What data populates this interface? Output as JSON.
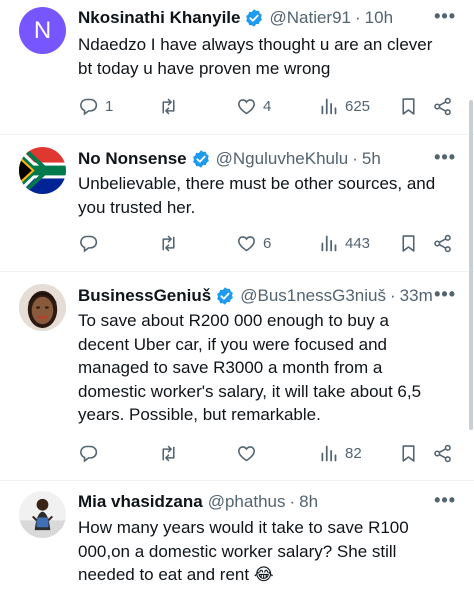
{
  "tweets": [
    {
      "name": "Nkosinathi Khanyile",
      "handle": "@Natier91",
      "time": "10h",
      "avatar_letter": "N",
      "avatar_color": "#7856ff",
      "verified": true,
      "lines": [
        "Ndaedzo I have always thought u are an clever",
        "bt today u have proven me wrong"
      ],
      "replies": "1",
      "retweets": "",
      "likes": "4",
      "views": "625"
    },
    {
      "name": "No Nonsense",
      "handle": "@NguluvheKhulu",
      "time": "5h",
      "avatar_icon": "south-africa-flag-icon",
      "verified": true,
      "lines": [
        "Unbelievable, there must be other sources, and",
        "you trusted her."
      ],
      "replies": "",
      "retweets": "",
      "likes": "6",
      "views": "443"
    },
    {
      "name": "BusinessGeniuš",
      "handle": "@Bus1nessG3niuš",
      "time": "33m",
      "avatar_icon": "profile-photo",
      "verified": true,
      "lines": [
        "To save about R200 000 enough to buy a",
        "decent Uber car, if you were focused and",
        "managed to save R3000 a month from a",
        "domestic worker's salary, it will take about 6,5",
        "years. Possible, but remarkable."
      ],
      "replies": "",
      "retweets": "",
      "likes": "",
      "views": "82"
    },
    {
      "name": "Mia vhasidzana",
      "handle": "@phathus",
      "time": "8h",
      "avatar_icon": "profile-photo",
      "verified": false,
      "lines": [
        "How many years would it take to save R100",
        "000,on a domestic worker salary?  She still",
        "needed to eat and rent 😂"
      ]
    }
  ],
  "more_label": "•••",
  "time_separator": "·",
  "colors": {
    "verified": "#1d9bf0",
    "secondary_text": "#536471",
    "separator": "#eff3f4"
  }
}
